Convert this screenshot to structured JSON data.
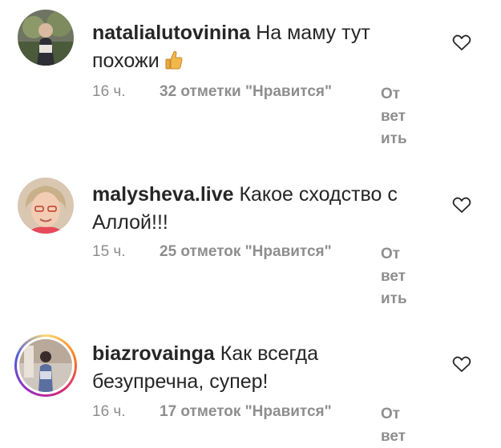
{
  "comments": [
    {
      "username": "natalialutovinina",
      "text": "На маму тут похожи",
      "emoji": "thumbs-up",
      "time": "16 ч.",
      "likes": "32 отметки \"Нравится\"",
      "reply": [
        "От",
        "вет",
        "ить"
      ]
    },
    {
      "username": "malysheva.live",
      "text": "Какое сходство с Аллой!!!",
      "time": "15 ч.",
      "likes": "25 отметок \"Нравится\"",
      "reply": [
        "От",
        "вет",
        "ить"
      ]
    },
    {
      "username": "biazrovainga",
      "text": "Как всегда безупречна, супер!",
      "time": "16 ч.",
      "likes": "17 отметок \"Нравится\"",
      "reply": [
        "От",
        "вет"
      ]
    }
  ],
  "colors": {
    "text": "#262626",
    "secondary": "#8e8e8e"
  },
  "icons": {
    "like": "heart-outline-icon"
  }
}
